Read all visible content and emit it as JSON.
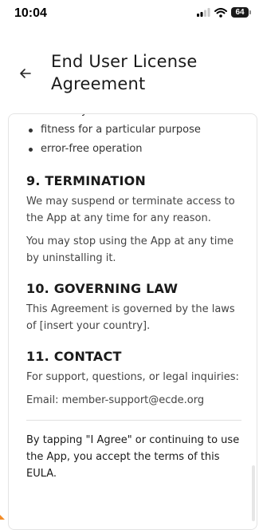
{
  "status_bar": {
    "time": "10:04",
    "battery": "64"
  },
  "header": {
    "title": "End User License Agreement"
  },
  "eula": {
    "partial_bullet": "accuracy",
    "bullets": [
      "fitness for a particular purpose",
      "error-free operation"
    ],
    "sections": [
      {
        "heading": "9. TERMINATION",
        "paragraphs": [
          "We may suspend or terminate access to the App at any time for any reason.",
          "You may stop using the App at any time by uninstalling it."
        ]
      },
      {
        "heading": "10. GOVERNING LAW",
        "paragraphs": [
          "This Agreement is governed by the laws of [insert your country]."
        ]
      },
      {
        "heading": "11. CONTACT",
        "paragraphs": [
          "For support, questions, or legal inquiries:",
          "Email: member-support@ecde.org"
        ]
      }
    ],
    "agree_text": "By tapping \"I Agree\" or continuing to use the App, you accept the terms of this EULA."
  },
  "colors": {
    "text": "#222222",
    "border": "#e4e4e4",
    "accent": "#f28c28"
  },
  "icons": [
    "signal-icon",
    "wifi-icon",
    "battery-icon",
    "back-arrow-icon"
  ]
}
